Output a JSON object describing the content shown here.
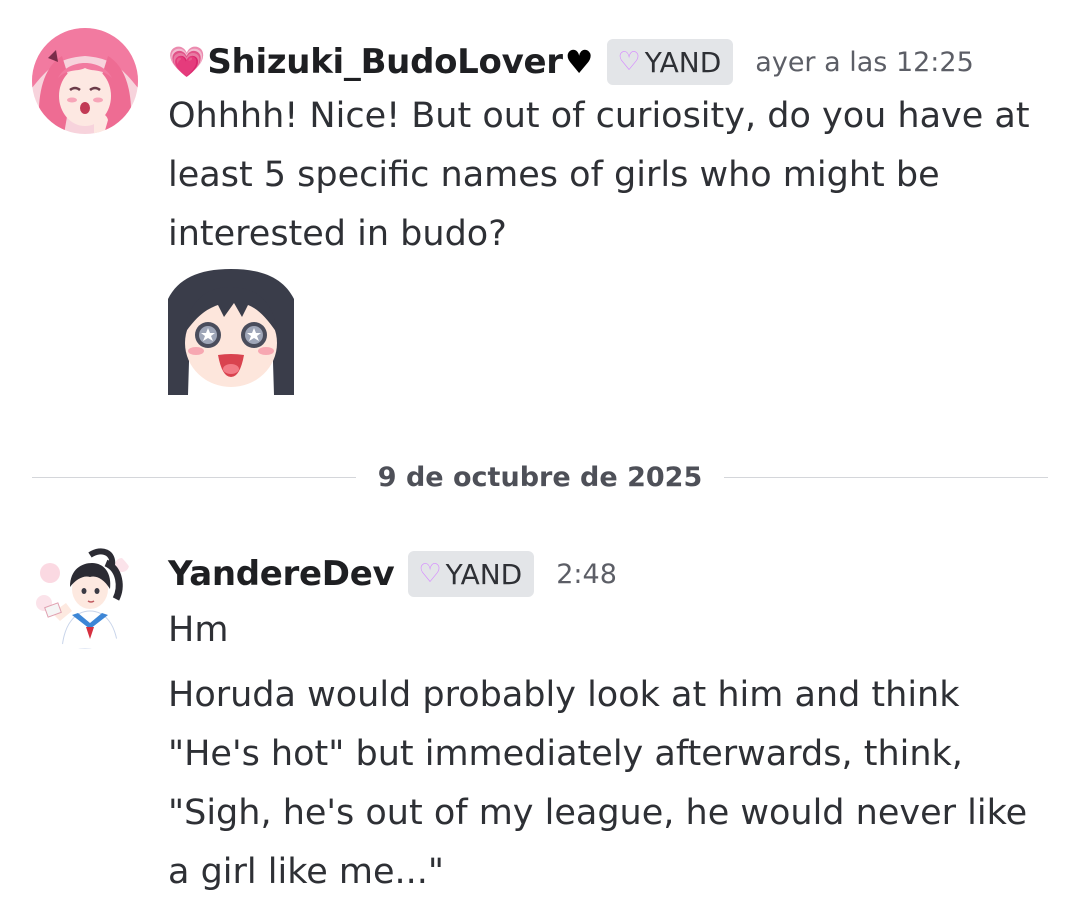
{
  "messages": [
    {
      "author": "Shizuki_BudoLover",
      "author_prefix_icon": "pink-heart",
      "author_suffix_icon": "black-heart",
      "tag": "YAND",
      "tag_icon": "heart-outline",
      "timestamp": "ayer a las 12:25",
      "lines": [
        "Ohhhh! Nice! But out of curiosity, do you have at least 5 specific names of girls who might be interested in budo?"
      ],
      "attachment": "sticker-excited-girl"
    },
    {
      "author": "YandereDev",
      "tag": "YAND",
      "tag_icon": "heart-outline",
      "timestamp": "2:48",
      "lines": [
        "Hm",
        "Horuda would probably look at him and think \"He's hot\" but immediately afterwards, think, \"Sigh, he's out of my league, he would never like a girl like me...\""
      ]
    }
  ],
  "divider": {
    "date": "9 de octubre de 2025"
  },
  "colors": {
    "username": "#1e1f22",
    "text": "#2e3035",
    "timestamp": "#5c5e66",
    "tag_bg": "#e3e5e8",
    "divider_line": "#d4d6da"
  }
}
